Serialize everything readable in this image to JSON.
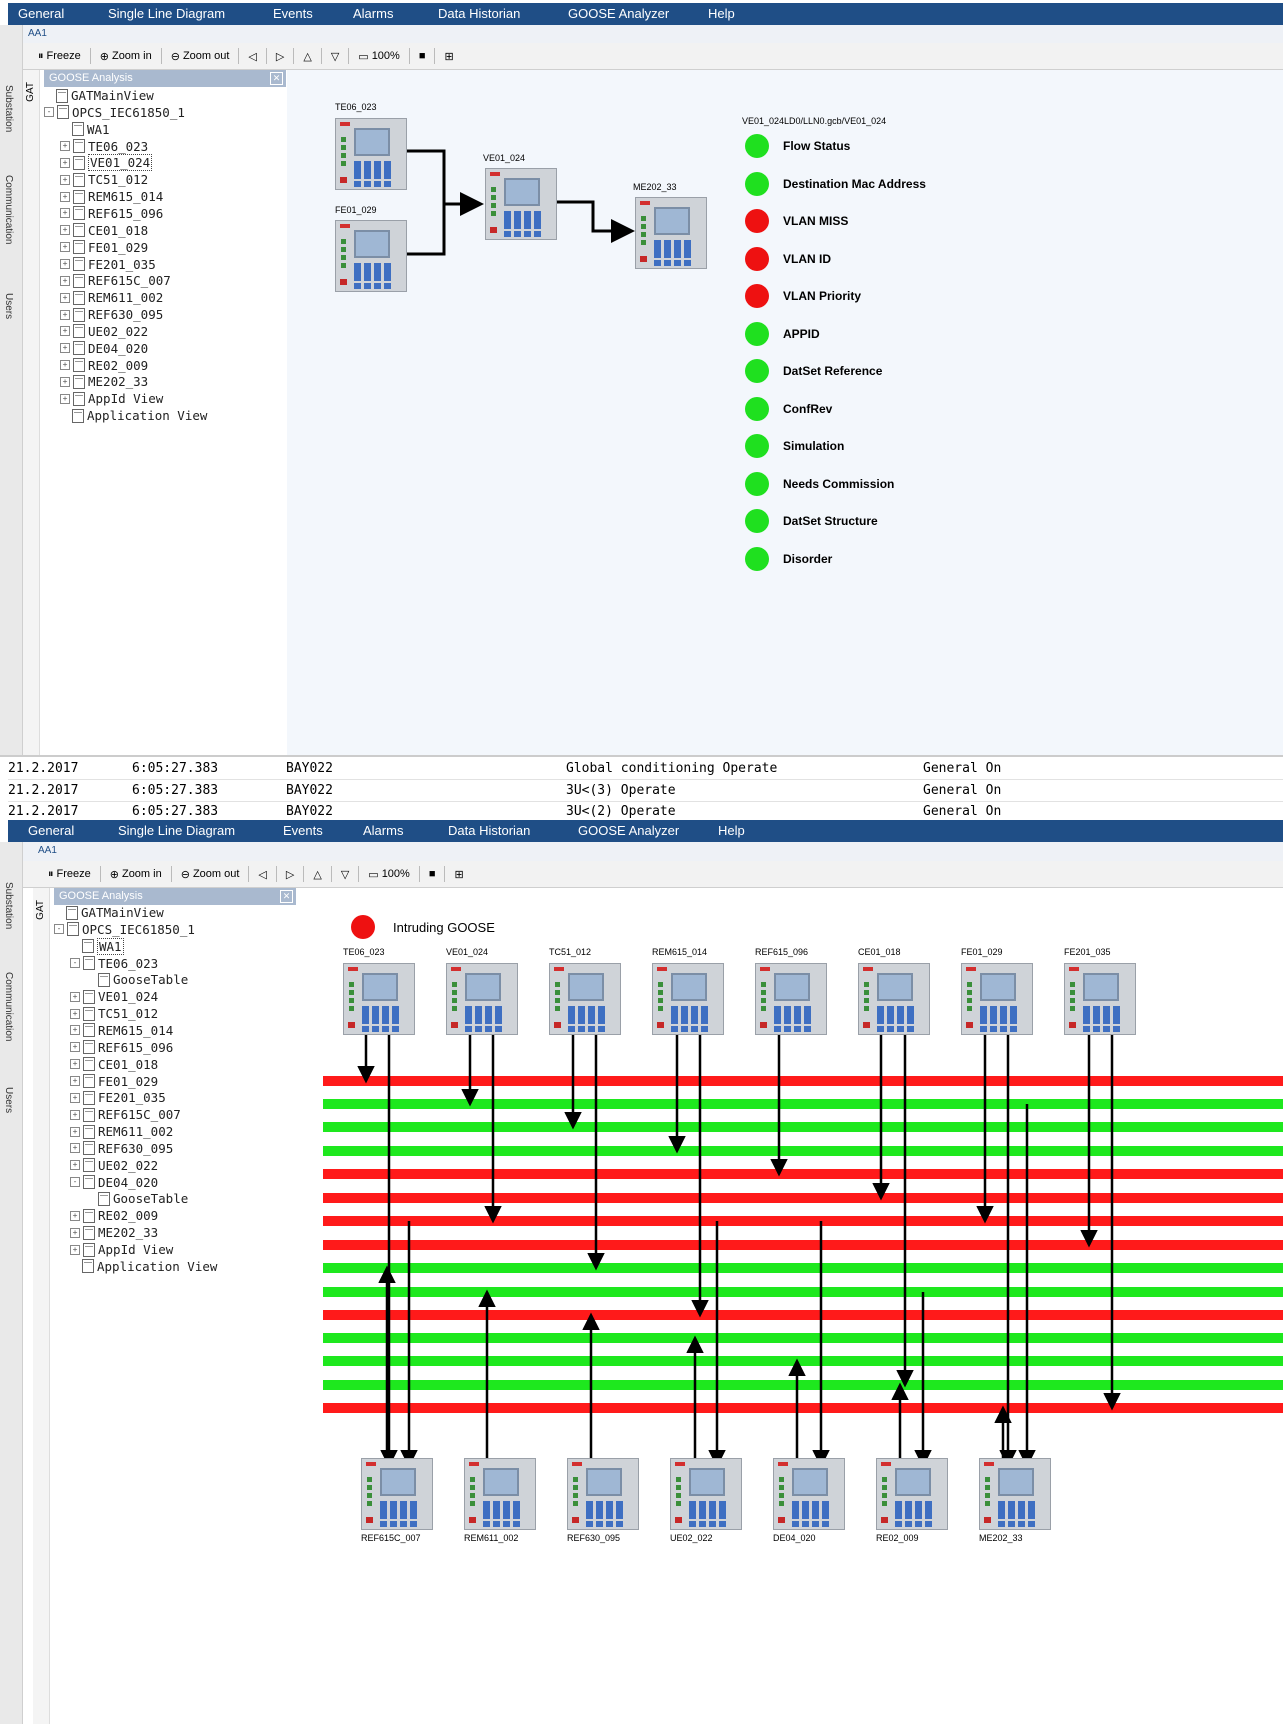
{
  "menu": [
    "General",
    "Single Line Diagram",
    "Events",
    "Alarms",
    "Data Historian",
    "GOOSE Analyzer",
    "Help"
  ],
  "address": "AA1",
  "toolbar": {
    "freeze": "Freeze",
    "zoom_in": "Zoom in",
    "zoom_out": "Zoom out",
    "zoom_level": "100%"
  },
  "vtabs": [
    "Substation",
    "Communication",
    "Users"
  ],
  "gat_label": "GAT",
  "panel_title": "GOOSE Analysis",
  "tree_top": [
    {
      "label": "GATMainView",
      "level": 0,
      "exp": ""
    },
    {
      "label": "OPCS_IEC61850_1",
      "level": 0,
      "exp": "-"
    },
    {
      "label": "WA1",
      "level": 1,
      "exp": ""
    },
    {
      "label": "TE06_023",
      "level": 1,
      "exp": "+"
    },
    {
      "label": "VE01_024",
      "level": 1,
      "exp": "+"
    },
    {
      "label": "TC51_012",
      "level": 1,
      "exp": "+"
    },
    {
      "label": "REM615_014",
      "level": 1,
      "exp": "+"
    },
    {
      "label": "REF615_096",
      "level": 1,
      "exp": "+"
    },
    {
      "label": "CE01_018",
      "level": 1,
      "exp": "+"
    },
    {
      "label": "FE01_029",
      "level": 1,
      "exp": "+"
    },
    {
      "label": "FE201_035",
      "level": 1,
      "exp": "+"
    },
    {
      "label": "REF615C_007",
      "level": 1,
      "exp": "+"
    },
    {
      "label": "REM611_002",
      "level": 1,
      "exp": "+"
    },
    {
      "label": "REF630_095",
      "level": 1,
      "exp": "+"
    },
    {
      "label": "UE02_022",
      "level": 1,
      "exp": "+"
    },
    {
      "label": "DE04_020",
      "level": 1,
      "exp": "+"
    },
    {
      "label": "RE02_009",
      "level": 1,
      "exp": "+"
    },
    {
      "label": "ME202_33",
      "level": 1,
      "exp": "+"
    },
    {
      "label": "AppId View",
      "level": 1,
      "exp": "+"
    },
    {
      "label": "Application View",
      "level": 1,
      "exp": ""
    }
  ],
  "tree_bottom": [
    {
      "label": "GATMainView",
      "level": 0,
      "exp": ""
    },
    {
      "label": "OPCS_IEC61850_1",
      "level": 0,
      "exp": "-"
    },
    {
      "label": "WA1",
      "level": 1,
      "exp": ""
    },
    {
      "label": "TE06_023",
      "level": 1,
      "exp": "-"
    },
    {
      "label": "GooseTable",
      "level": 2,
      "exp": ""
    },
    {
      "label": "VE01_024",
      "level": 1,
      "exp": "+"
    },
    {
      "label": "TC51_012",
      "level": 1,
      "exp": "+"
    },
    {
      "label": "REM615_014",
      "level": 1,
      "exp": "+"
    },
    {
      "label": "REF615_096",
      "level": 1,
      "exp": "+"
    },
    {
      "label": "CE01_018",
      "level": 1,
      "exp": "+"
    },
    {
      "label": "FE01_029",
      "level": 1,
      "exp": "+"
    },
    {
      "label": "FE201_035",
      "level": 1,
      "exp": "+"
    },
    {
      "label": "REF615C_007",
      "level": 1,
      "exp": "+"
    },
    {
      "label": "REM611_002",
      "level": 1,
      "exp": "+"
    },
    {
      "label": "REF630_095",
      "level": 1,
      "exp": "+"
    },
    {
      "label": "UE02_022",
      "level": 1,
      "exp": "+"
    },
    {
      "label": "DE04_020",
      "level": 1,
      "exp": "-"
    },
    {
      "label": "GooseTable",
      "level": 2,
      "exp": ""
    },
    {
      "label": "RE02_009",
      "level": 1,
      "exp": "+"
    },
    {
      "label": "ME202_33",
      "level": 1,
      "exp": "+"
    },
    {
      "label": "AppId View",
      "level": 1,
      "exp": "+"
    },
    {
      "label": "Application View",
      "level": 1,
      "exp": ""
    }
  ],
  "top_diagram": {
    "ied_labels": [
      "TE06_023",
      "FE01_029",
      "VE01_024",
      "ME202_33"
    ],
    "status_title": "VE01_024LD0/LLN0.gcb/VE01_024",
    "status_items": [
      {
        "label": "Flow Status",
        "state": "ok"
      },
      {
        "label": "Destination Mac Address",
        "state": "ok"
      },
      {
        "label": "VLAN MISS",
        "state": "err"
      },
      {
        "label": "VLAN ID",
        "state": "err"
      },
      {
        "label": "VLAN Priority",
        "state": "err"
      },
      {
        "label": "APPID",
        "state": "ok"
      },
      {
        "label": "DatSet Reference",
        "state": "ok"
      },
      {
        "label": "ConfRev",
        "state": "ok"
      },
      {
        "label": "Simulation",
        "state": "ok"
      },
      {
        "label": "Needs Commission",
        "state": "ok"
      },
      {
        "label": "DatSet Structure",
        "state": "ok"
      },
      {
        "label": "Disorder",
        "state": "ok"
      }
    ]
  },
  "colors": {
    "ok": "#1fe01f",
    "err": "#ee1111",
    "line_red": "#ff1a1a",
    "line_green": "#1ee81e",
    "menubar": "#1f4e86"
  },
  "events": [
    {
      "date": "21.2.2017",
      "time": "6:05:27.383",
      "bay": "BAY022",
      "text": "Global conditioning Operate",
      "state": "General On"
    },
    {
      "date": "21.2.2017",
      "time": "6:05:27.383",
      "bay": "BAY022",
      "text": "3U<(3) Operate",
      "state": "General On"
    },
    {
      "date": "21.2.2017",
      "time": "6:05:27.383",
      "bay": "BAY022",
      "text": "3U<(2) Operate",
      "state": "General On"
    }
  ],
  "bottom_diagram": {
    "legend": "Intruding GOOSE",
    "top_ieds": [
      "TE06_023",
      "VE01_024",
      "TC51_012",
      "REM615_014",
      "REF615_096",
      "CE01_018",
      "FE01_029",
      "FE201_035"
    ],
    "bottom_ieds": [
      "REF615C_007",
      "REM611_002",
      "REF630_095",
      "UE02_022",
      "DE04_020",
      "RE02_009",
      "ME202_33"
    ],
    "bus_lines": [
      "red",
      "green",
      "green",
      "green",
      "red",
      "red",
      "red",
      "red",
      "green",
      "green",
      "red",
      "green",
      "green",
      "green",
      "red"
    ]
  }
}
